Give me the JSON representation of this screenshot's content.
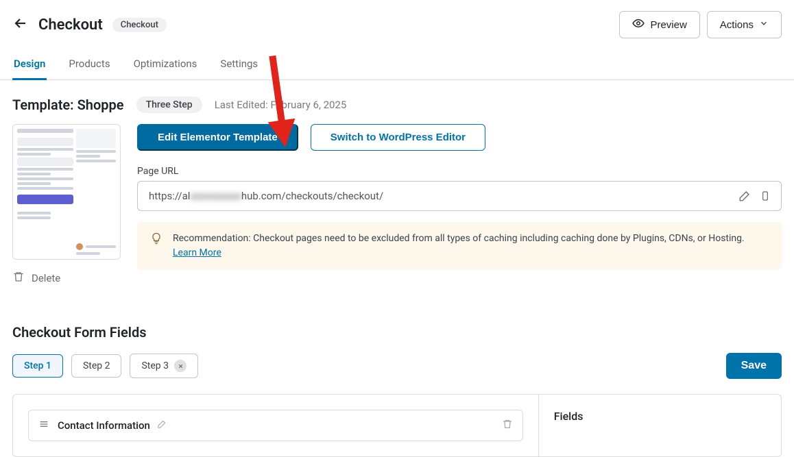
{
  "header": {
    "title": "Checkout",
    "badge": "Checkout",
    "preview_btn": "Preview",
    "actions_btn": "Actions"
  },
  "tabs": [
    {
      "label": "Design"
    },
    {
      "label": "Products"
    },
    {
      "label": "Optimizations"
    },
    {
      "label": "Settings"
    }
  ],
  "template": {
    "title": "Template: Shoppe",
    "pill": "Three Step",
    "last_edited": "Last Edited: February 6, 2025",
    "edit_elementor": "Edit Elementor Template",
    "switch_wp": "Switch to WordPress Editor",
    "delete": "Delete",
    "page_url_label": "Page URL",
    "page_url_prefix": "https://al",
    "page_url_blurred": "xxxxxxxxxx",
    "page_url_suffix": "hub.com/checkouts/checkout/",
    "reco_text": "Recommendation: Checkout pages need to be excluded from all types of caching including caching done by Plugins, CDNs, or Hosting. ",
    "reco_link": "Learn More"
  },
  "form_fields": {
    "heading": "Checkout Form Fields",
    "steps": [
      {
        "label": "Step 1"
      },
      {
        "label": "Step 2"
      },
      {
        "label": "Step 3"
      }
    ],
    "save_btn": "Save",
    "fields_panel_title": "Fields",
    "contact_info_label": "Contact Information"
  }
}
